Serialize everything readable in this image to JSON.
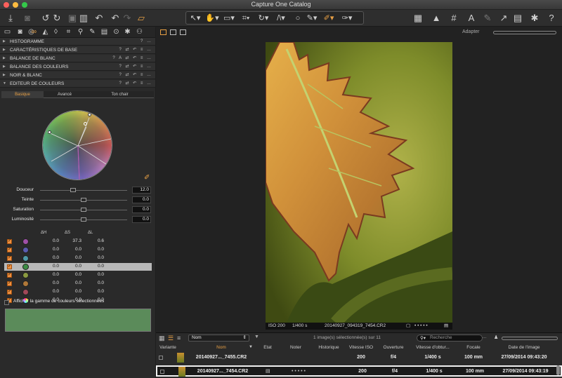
{
  "window": {
    "title": "Capture One Catalog"
  },
  "toolbar": {
    "left_icons": [
      "import-icon",
      "camera-icon",
      "rotate-left-icon",
      "rotate-right-icon",
      "adjust-icon",
      "trash-icon",
      "undo-icon",
      "redo-left-icon",
      "redo-right-icon",
      "stack-icon"
    ],
    "cursor_tools": [
      "select-icon",
      "hand-icon",
      "crop-icon",
      "straighten-icon",
      "rotate-icon",
      "keystone-icon",
      "circle-icon",
      "brush-icon",
      "picker-icon",
      "eraser-icon"
    ],
    "right_icons": [
      "grid-icon",
      "warning-icon",
      "grid-overlay-icon",
      "text-icon",
      "wrench-icon",
      "arrow-icon",
      "print-icon",
      "gear-icon",
      "help-icon"
    ],
    "adapt_label": "Adapter"
  },
  "sections": [
    {
      "label": "HISTOGRAMME",
      "controls": "? …"
    },
    {
      "label": "CARACTÉRISTIQUES DE BASE",
      "controls": "? ⇄ ↶ ≡ …"
    },
    {
      "label": "BALANCE DE BLANC",
      "controls": "? A ⇄ ↶ ≡ …"
    },
    {
      "label": "BALANCE DES COULEURS",
      "controls": "? ⇄ ↶ ≡ …"
    },
    {
      "label": "NOIR & BLANC",
      "controls": "? ⇄ ↶ ≡ …"
    },
    {
      "label": "EDITEUR DE COULEURS",
      "controls": "? ⇄ ↶ ≡ …"
    }
  ],
  "editor_tabs": [
    "Basique",
    "Avancé",
    "Ton chair"
  ],
  "sliders": [
    {
      "label": "Douceur",
      "value": "12.0"
    },
    {
      "label": "Teinte",
      "value": "0.0"
    },
    {
      "label": "Saturation",
      "value": "0.0"
    },
    {
      "label": "Luminosité",
      "value": "0.0"
    }
  ],
  "color_table": {
    "headers": [
      "ΔH",
      "ΔS",
      "ΔL"
    ],
    "rows": [
      {
        "color": "#a050a8",
        "h": "0.0",
        "s": "37.3",
        "l": "0.6",
        "selected": false
      },
      {
        "color": "#5a5cb0",
        "h": "0.0",
        "s": "0.0",
        "l": "0.0",
        "selected": false
      },
      {
        "color": "#4e9aa8",
        "h": "0.0",
        "s": "0.0",
        "l": "0.0",
        "selected": false
      },
      {
        "color": "#3c8c44",
        "h": "0.0",
        "s": "0.0",
        "l": "0.0",
        "selected": true
      },
      {
        "color": "#8a9a40",
        "h": "0.0",
        "s": "0.0",
        "l": "0.0",
        "selected": false
      },
      {
        "color": "#b07838",
        "h": "0.0",
        "s": "0.0",
        "l": "0.0",
        "selected": false
      },
      {
        "color": "#a04858",
        "h": "0.0",
        "s": "0.0",
        "l": "0.0",
        "selected": false
      },
      {
        "color": "rainbow",
        "h": "0.0",
        "s": "0.0",
        "l": "0.0",
        "selected": false
      }
    ]
  },
  "show_range_label": "Afficher la gamme de couleurs sélectionnées",
  "swatch_color": "#5b8b5a",
  "viewer": {
    "iso": "ISO 200",
    "shutter": "1/400 s",
    "filename": "20140927_094319_7454.CR2",
    "dots": "• • • • •"
  },
  "browser": {
    "sort_label": "Nom",
    "status": "1 image(s) sélectionnée(s) sur 11",
    "search_placeholder": "Recherche",
    "columns": [
      "Variante",
      "Nom",
      "Etat",
      "Noter",
      "Historique",
      "Vitesse ISO",
      "Ouverture",
      "Vitesse d'obtur...",
      "Focale",
      "Date de l'image"
    ],
    "rows": [
      {
        "name": "20140927..._7455.CR2",
        "iso": "200",
        "aperture": "f/4",
        "shutter": "1/400 s",
        "focal": "100 mm",
        "date": "27/09/2014 09:43:20",
        "rating": "",
        "selected": false
      },
      {
        "name": "20140927..._7454.CR2",
        "iso": "200",
        "aperture": "f/4",
        "shutter": "1/400 s",
        "focal": "100 mm",
        "date": "27/09/2014 09:43:19",
        "rating": "• • • • •",
        "selected": true
      }
    ]
  },
  "accent": "#e8a045"
}
